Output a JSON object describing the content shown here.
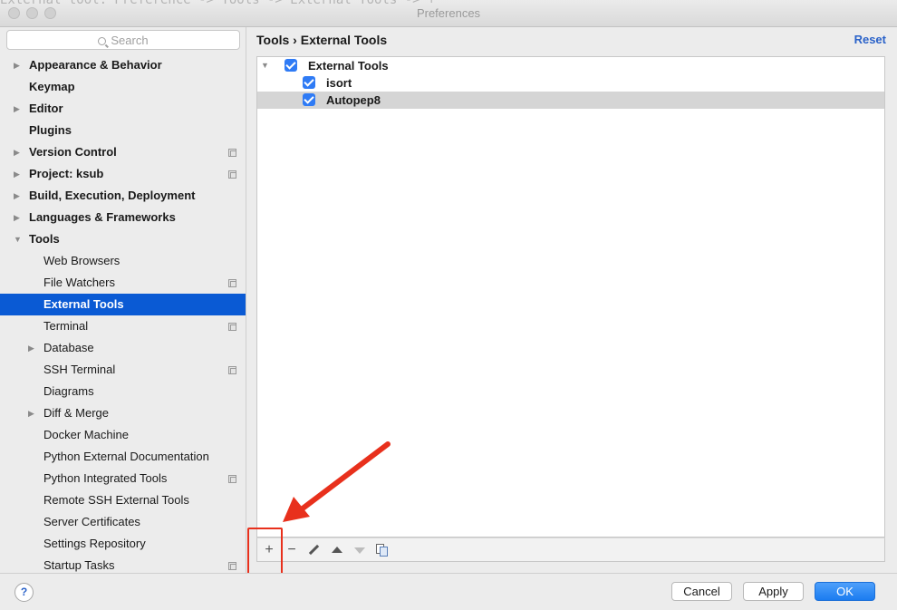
{
  "window": {
    "title": "Preferences",
    "background_text": "External tool:  Preference -> Tools -> External Tools -> +"
  },
  "sidebar": {
    "search_placeholder": "Search",
    "items": [
      {
        "label": "Appearance & Behavior",
        "level": 0,
        "expandable": true,
        "expanded": false,
        "project_icon": false
      },
      {
        "label": "Keymap",
        "level": 0,
        "expandable": false,
        "project_icon": false
      },
      {
        "label": "Editor",
        "level": 0,
        "expandable": true,
        "expanded": false,
        "project_icon": false
      },
      {
        "label": "Plugins",
        "level": 0,
        "expandable": false,
        "project_icon": false
      },
      {
        "label": "Version Control",
        "level": 0,
        "expandable": true,
        "expanded": false,
        "project_icon": true
      },
      {
        "label": "Project: ksub",
        "level": 0,
        "expandable": true,
        "expanded": false,
        "project_icon": true
      },
      {
        "label": "Build, Execution, Deployment",
        "level": 0,
        "expandable": true,
        "expanded": false,
        "project_icon": false
      },
      {
        "label": "Languages & Frameworks",
        "level": 0,
        "expandable": true,
        "expanded": false,
        "project_icon": false
      },
      {
        "label": "Tools",
        "level": 0,
        "expandable": true,
        "expanded": true,
        "project_icon": false
      },
      {
        "label": "Web Browsers",
        "level": 1,
        "expandable": false,
        "project_icon": false
      },
      {
        "label": "File Watchers",
        "level": 1,
        "expandable": false,
        "project_icon": true
      },
      {
        "label": "External Tools",
        "level": 1,
        "expandable": false,
        "project_icon": false,
        "selected": true
      },
      {
        "label": "Terminal",
        "level": 1,
        "expandable": false,
        "project_icon": true
      },
      {
        "label": "Database",
        "level": 1,
        "expandable": true,
        "expanded": false,
        "project_icon": false
      },
      {
        "label": "SSH Terminal",
        "level": 1,
        "expandable": false,
        "project_icon": true
      },
      {
        "label": "Diagrams",
        "level": 1,
        "expandable": false,
        "project_icon": false
      },
      {
        "label": "Diff & Merge",
        "level": 1,
        "expandable": true,
        "expanded": false,
        "project_icon": false
      },
      {
        "label": "Docker Machine",
        "level": 1,
        "expandable": false,
        "project_icon": false
      },
      {
        "label": "Python External Documentation",
        "level": 1,
        "expandable": false,
        "project_icon": false
      },
      {
        "label": "Python Integrated Tools",
        "level": 1,
        "expandable": false,
        "project_icon": true
      },
      {
        "label": "Remote SSH External Tools",
        "level": 1,
        "expandable": false,
        "project_icon": false
      },
      {
        "label": "Server Certificates",
        "level": 1,
        "expandable": false,
        "project_icon": false
      },
      {
        "label": "Settings Repository",
        "level": 1,
        "expandable": false,
        "project_icon": false
      },
      {
        "label": "Startup Tasks",
        "level": 1,
        "expandable": false,
        "project_icon": true
      }
    ]
  },
  "main": {
    "breadcrumb": "Tools › External Tools",
    "reset_label": "Reset",
    "tools": [
      {
        "label": "External Tools",
        "group": true,
        "checked": true,
        "expanded": true
      },
      {
        "label": "isort",
        "group": false,
        "checked": true
      },
      {
        "label": "Autopep8",
        "group": false,
        "checked": true,
        "selected": true
      }
    ],
    "toolbar": {
      "add": "+",
      "remove": "−"
    }
  },
  "footer": {
    "help": "?",
    "cancel_label": "Cancel",
    "apply_label": "Apply",
    "ok_label": "OK"
  },
  "colors": {
    "selection": "#0a5ad4",
    "checkbox": "#2f7bf5",
    "link": "#2a62c9",
    "annotation": "#e8301c"
  }
}
